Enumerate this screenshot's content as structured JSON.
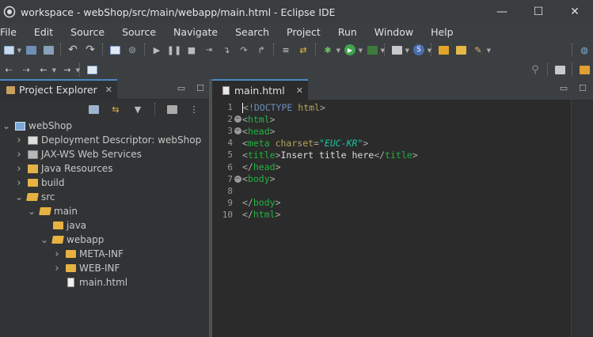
{
  "window": {
    "title": "workspace - webShop/src/main/webapp/main.html - Eclipse IDE",
    "minimize": "—",
    "maximize": "☐",
    "close": "✕"
  },
  "menu": [
    "File",
    "Edit",
    "Source",
    "Source",
    "Navigate",
    "Search",
    "Project",
    "Run",
    "Window",
    "Help"
  ],
  "project_explorer": {
    "tab_label": "Project Explorer",
    "close": "✕",
    "minimize": "▭",
    "maximize": "☐",
    "tree": [
      {
        "label": "webShop",
        "depth": 0,
        "expanded": "open",
        "icon": "project-icon"
      },
      {
        "label": "Deployment Descriptor: webShop",
        "depth": 1,
        "expanded": "closed",
        "icon": "deployment-descriptor-icon"
      },
      {
        "label": "JAX-WS Web Services",
        "depth": 1,
        "expanded": "closed",
        "icon": "web-services-icon"
      },
      {
        "label": "Java Resources",
        "depth": 1,
        "expanded": "closed",
        "icon": "java-resources-icon"
      },
      {
        "label": "build",
        "depth": 1,
        "expanded": "closed",
        "icon": "folder-icon"
      },
      {
        "label": "src",
        "depth": 1,
        "expanded": "open",
        "icon": "folder-open-icon"
      },
      {
        "label": "main",
        "depth": 2,
        "expanded": "open",
        "icon": "folder-open-icon"
      },
      {
        "label": "java",
        "depth": 3,
        "expanded": "none",
        "icon": "folder-icon"
      },
      {
        "label": "webapp",
        "depth": 3,
        "expanded": "open",
        "icon": "folder-open-icon"
      },
      {
        "label": "META-INF",
        "depth": 4,
        "expanded": "closed",
        "icon": "folder-icon"
      },
      {
        "label": "WEB-INF",
        "depth": 4,
        "expanded": "closed",
        "icon": "folder-icon"
      },
      {
        "label": "main.html",
        "depth": 4,
        "expanded": "none",
        "icon": "html-file-icon"
      }
    ]
  },
  "editor": {
    "tab_label": "main.html",
    "close": "✕",
    "minimize": "▭",
    "maximize": "☐",
    "lines": [
      {
        "num": "1",
        "fold": "",
        "tokens": [
          [
            "br",
            "<"
          ],
          [
            "doc",
            "!DOCTYPE"
          ],
          [
            "text",
            " "
          ],
          [
            "attr",
            "html"
          ],
          [
            "br",
            ">"
          ]
        ]
      },
      {
        "num": "2",
        "fold": "−",
        "tokens": [
          [
            "br",
            "<"
          ],
          [
            "tag",
            "html"
          ],
          [
            "br",
            ">"
          ]
        ]
      },
      {
        "num": "3",
        "fold": "−",
        "tokens": [
          [
            "br",
            "<"
          ],
          [
            "tag",
            "head"
          ],
          [
            "br",
            ">"
          ]
        ]
      },
      {
        "num": "4",
        "fold": "",
        "tokens": [
          [
            "br",
            "<"
          ],
          [
            "tag",
            "meta"
          ],
          [
            "text",
            " "
          ],
          [
            "attr",
            "charset"
          ],
          [
            "br",
            "="
          ],
          [
            "str",
            "\"EUC-KR\""
          ],
          [
            "br",
            ">"
          ]
        ]
      },
      {
        "num": "5",
        "fold": "",
        "tokens": [
          [
            "br",
            "<"
          ],
          [
            "tag",
            "title"
          ],
          [
            "br",
            ">"
          ],
          [
            "text",
            "Insert title here"
          ],
          [
            "br",
            "</"
          ],
          [
            "tag",
            "title"
          ],
          [
            "br",
            ">"
          ]
        ]
      },
      {
        "num": "6",
        "fold": "",
        "tokens": [
          [
            "br",
            "</"
          ],
          [
            "tag",
            "head"
          ],
          [
            "br",
            ">"
          ]
        ]
      },
      {
        "num": "7",
        "fold": "−",
        "tokens": [
          [
            "br",
            "<"
          ],
          [
            "tag",
            "body"
          ],
          [
            "br",
            ">"
          ]
        ]
      },
      {
        "num": "8",
        "fold": "",
        "tokens": []
      },
      {
        "num": "9",
        "fold": "",
        "tokens": [
          [
            "br",
            "</"
          ],
          [
            "tag",
            "body"
          ],
          [
            "br",
            ">"
          ]
        ]
      },
      {
        "num": "10",
        "fold": "",
        "tokens": [
          [
            "br",
            "</"
          ],
          [
            "tag",
            "html"
          ],
          [
            "br",
            ">"
          ]
        ]
      }
    ]
  },
  "colors": {
    "accent": "#4a88c7",
    "tag": "#1eb540",
    "attribute": "#b4a55a",
    "string": "#17c6a3",
    "doctype": "#6a8fbf"
  }
}
